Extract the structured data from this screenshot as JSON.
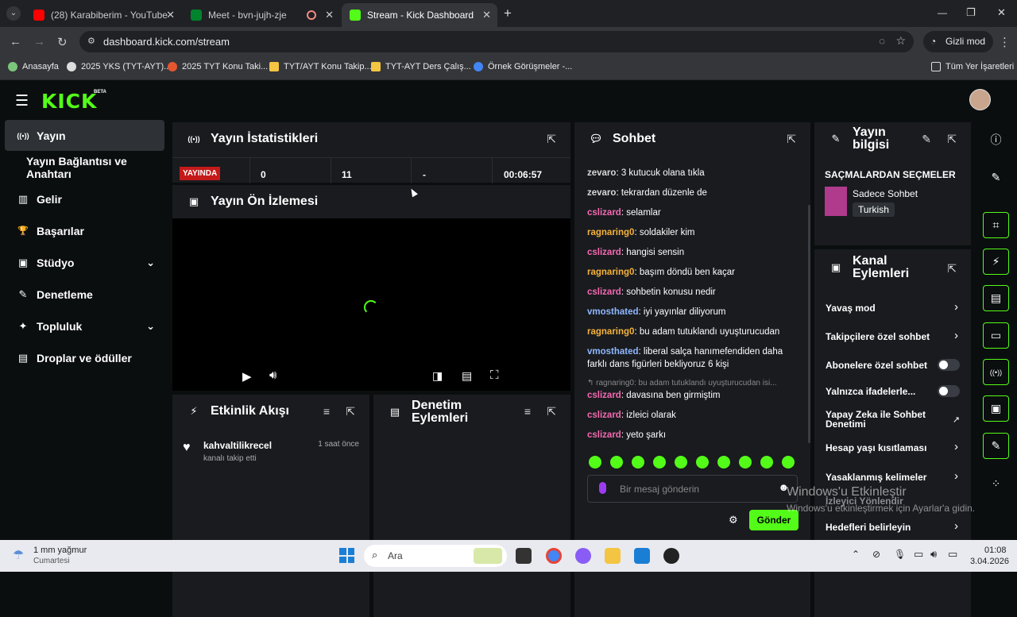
{
  "browser": {
    "tabs": [
      {
        "title": "(28) Karabiberim - YouTube",
        "close": "✕"
      },
      {
        "title": "Meet - bvn-jujh-zje",
        "close": "✕"
      },
      {
        "title": "Stream - Kick Dashboard",
        "close": "✕"
      }
    ],
    "new_tab": "+",
    "url": "dashboard.kick.com/stream",
    "incognito_label": "Gizli mod",
    "bookmarks": [
      "Anasayfa",
      "2025 YKS (TYT-AYT)...",
      "2025 TYT Konu Taki...",
      "TYT/AYT Konu Takip...",
      "TYT-AYT Ders Çalış...",
      "Örnek Görüşmeler -..."
    ],
    "all_bookmarks": "Tüm Yer İşaretleri",
    "window_controls": [
      "—",
      "❐",
      "✕"
    ]
  },
  "app": {
    "logo": "KICK",
    "beta": "BETA",
    "sidebar": [
      {
        "label": "Yayın",
        "icon": "((•))"
      },
      {
        "label": "Yayın Bağlantısı ve Anahtarı",
        "icon": ""
      },
      {
        "label": "Gelir",
        "icon": "▥"
      },
      {
        "label": "Başarılar",
        "icon": "🏆"
      },
      {
        "label": "Stüdyo",
        "icon": "▣",
        "chevron": "⌄"
      },
      {
        "label": "Denetleme",
        "icon": "✎"
      },
      {
        "label": "Topluluk",
        "icon": "✦",
        "chevron": "⌄"
      },
      {
        "label": "Droplar ve ödüller",
        "icon": "▤"
      }
    ],
    "stats": {
      "title": "Yayın İstatistikleri",
      "live_badge": "YAYINDA",
      "values": [
        "0",
        "11",
        "-",
        "00:06:57"
      ]
    },
    "preview": {
      "title": "Yayın Ön İzlemesi"
    },
    "activity": {
      "title": "Etkinlik Akışı",
      "item_user": "kahvaltilikrecel",
      "item_time": "1 saat önce",
      "item_text": "kanalı takip etti"
    },
    "mod_actions": {
      "title": "Denetim Eylemleri"
    },
    "chat": {
      "title": "Sohbet",
      "messages": [
        {
          "user": "zevaro",
          "text": ": 3 kutucuk olana tıkla",
          "color": "#d8d8d8"
        },
        {
          "user": "zevaro",
          "text": ": tekrardan düzenle de",
          "color": "#d8d8d8"
        },
        {
          "user": "cslizard",
          "text": ": selamlar",
          "color": "#f569b1"
        },
        {
          "user": "ragnaring0",
          "text": ": soldakiler kim",
          "color": "#f5b33d"
        },
        {
          "user": "cslizard",
          "text": ": hangisi sensin",
          "color": "#f569b1"
        },
        {
          "user": "ragnaring0",
          "text": ": başım döndü ben kaçar",
          "color": "#f5b33d"
        },
        {
          "user": "cslizard",
          "text": ": sohbetin konusu nedir",
          "color": "#f569b1"
        },
        {
          "user": "vmosthated",
          "text": ": iyi yayınlar diliyorum",
          "color": "#8fb8ff"
        },
        {
          "user": "ragnaring0",
          "text": ": bu adam tutuklandı uyuşturucudan",
          "color": "#f5b33d"
        },
        {
          "user": "vmosthated",
          "text": ": liberal salça hanımefendiden daha farklı dans figürleri bekliyoruz 6 kişi",
          "color": "#8fb8ff"
        }
      ],
      "reply_ref": "↰ ragnaring0: bu adam tutuklandı uyuşturucudan isi...",
      "messages2": [
        {
          "user": "cslizard",
          "text": ": davasına ben girmiştim",
          "color": "#f569b1"
        },
        {
          "user": "cslizard",
          "text": ": izleici olarak",
          "color": "#f569b1"
        },
        {
          "user": "cslizard",
          "text": ": yeto şarkı",
          "color": "#f569b1"
        }
      ],
      "placeholder": "Bir mesaj gönderin",
      "send": "Gönder"
    },
    "stream_info": {
      "title": "Yayın bilgisi",
      "stream_title": "SAÇMALARDAN SEÇMELER",
      "category": "Sadece Sohbet",
      "language": "Turkish"
    },
    "channel_actions": {
      "title": "Kanal Eylemleri",
      "items": [
        {
          "label": "Yavaş mod",
          "type": "arrow"
        },
        {
          "label": "Takipçilere özel sohbet",
          "type": "arrow"
        },
        {
          "label": "Abonelere özel sohbet",
          "type": "toggle"
        },
        {
          "label": "Yalnızca ifadelerle...",
          "type": "toggle"
        },
        {
          "label": "Yapay Zeka ile Sohbet Denetimi",
          "type": "external"
        },
        {
          "label": "Hesap yaşı kısıtlaması",
          "type": "arrow"
        },
        {
          "label": "Yasaklanmış kelimeler",
          "type": "arrow"
        },
        {
          "label": "İzleyici Yönlendir",
          "type": "arrow"
        },
        {
          "label": "Hedefleri belirleyin",
          "type": "arrow"
        }
      ]
    }
  },
  "watermark": {
    "line1": "Windows'u Etkinleştir",
    "line2": "Windows'u etkinleştirmek için Ayarlar'a gidin."
  },
  "taskbar": {
    "weather_temp": "1 mm yağmur",
    "weather_day": "Cumartesi",
    "search": "Ara",
    "time": "01:08",
    "date": "3.04.2026"
  },
  "colors": {
    "accent": "#53fc18",
    "live": "#c41a1a"
  }
}
